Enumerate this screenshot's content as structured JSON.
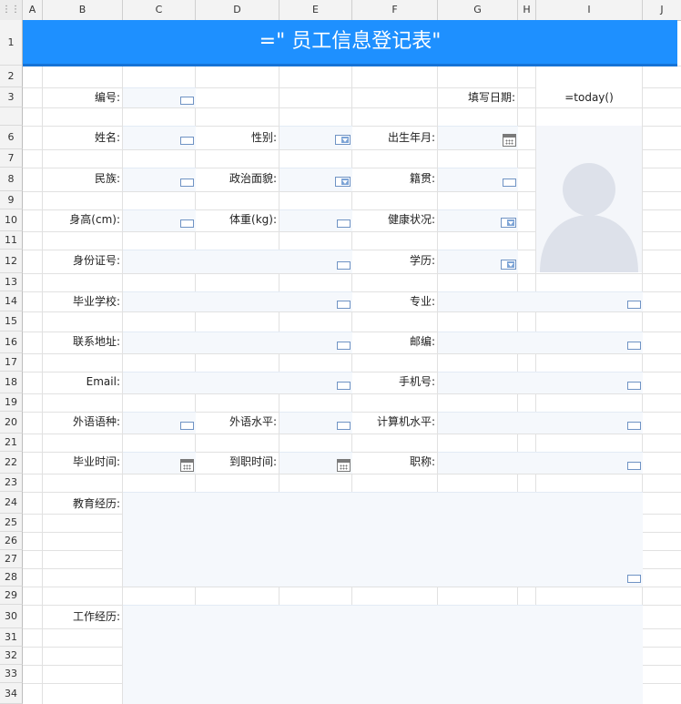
{
  "columns": [
    "A",
    "B",
    "C",
    "D",
    "E",
    "F",
    "G",
    "H",
    "I",
    "J"
  ],
  "rows": [
    "1",
    "2",
    "3",
    "6",
    "7",
    "8",
    "9",
    "10",
    "11",
    "12",
    "13",
    "14",
    "15",
    "16",
    "17",
    "18",
    "19",
    "20",
    "21",
    "22",
    "23",
    "24",
    "25",
    "26",
    "27",
    "28",
    "29",
    "30",
    "31",
    "32",
    "33",
    "34"
  ],
  "title": "=\"  员工信息登记表\"",
  "labels": {
    "id": "编号:",
    "fill_date": "填写日期:",
    "name": "姓名:",
    "gender": "性别:",
    "birth": "出生年月:",
    "ethnic": "民族:",
    "political": "政治面貌:",
    "native": "籍贯:",
    "height": "身高(cm):",
    "weight": "体重(kg):",
    "health": "健康状况:",
    "idcard": "身份证号:",
    "education": "学历:",
    "school": "毕业学校:",
    "major": "专业:",
    "address": "联系地址:",
    "zip": "邮编:",
    "email": "Email:",
    "phone": "手机号:",
    "lang": "外语语种:",
    "lang_level": "外语水平:",
    "computer": "计算机水平:",
    "grad_time": "毕业时间:",
    "join_time": "到职时间:",
    "title": "职称:",
    "edu_history": "教育经历:",
    "work_history": "工作经历:"
  },
  "values": {
    "fill_date": "=today()"
  },
  "icons": {
    "text_widget": "textbox-widget-icon",
    "dropdown": "dropdown-icon",
    "calendar": "calendar-icon",
    "photo": "person-silhouette-icon"
  },
  "colors": {
    "banner": "#1e90ff",
    "field_bg": "#f5f8fc",
    "widget_border": "#6f93c4"
  }
}
